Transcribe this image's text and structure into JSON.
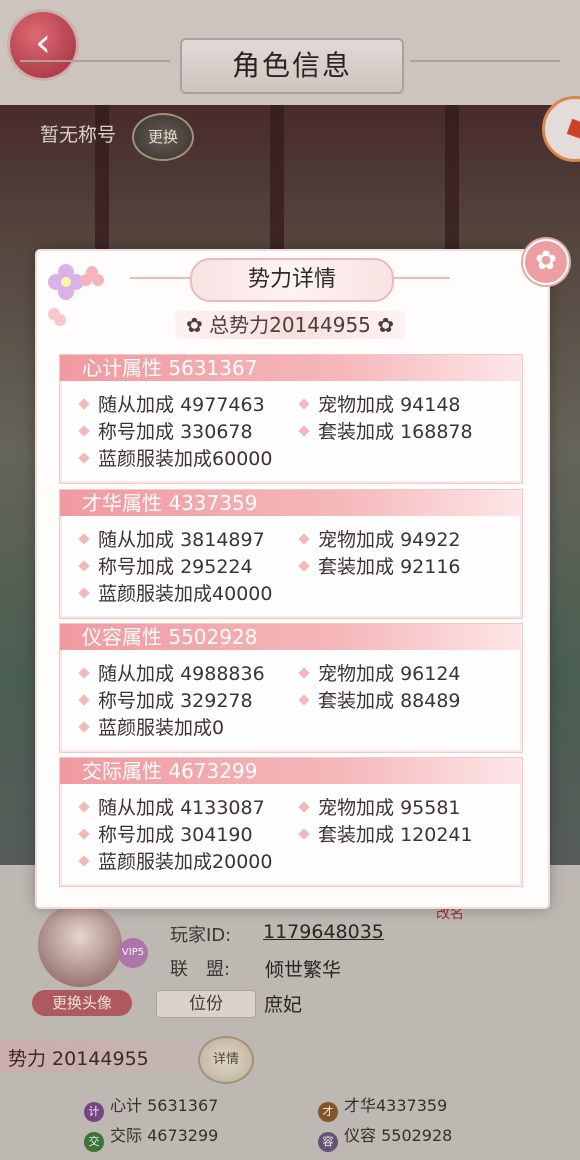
{
  "header": {
    "title": "角色信息",
    "back_icon": "‹"
  },
  "scene": {
    "no_title": "暂无称号",
    "change_label": "更换"
  },
  "modal": {
    "title": "势力详情",
    "total_power": "总势力20144955",
    "close_icon": "✿",
    "sections": [
      {
        "title": "心计属性 5631367",
        "rows": [
          {
            "label": "随从加成",
            "value": "4977463"
          },
          {
            "label": "宠物加成",
            "value": "94148"
          },
          {
            "label": "称号加成",
            "value": "330678"
          },
          {
            "label": "套装加成",
            "value": "168878"
          },
          {
            "label": "蓝颜服装加成",
            "value": "60000"
          }
        ]
      },
      {
        "title": "才华属性 4337359",
        "rows": [
          {
            "label": "随从加成",
            "value": "3814897"
          },
          {
            "label": "宠物加成",
            "value": "94922"
          },
          {
            "label": "称号加成",
            "value": "295224"
          },
          {
            "label": "套装加成",
            "value": "92116"
          },
          {
            "label": "蓝颜服装加成",
            "value": "40000"
          }
        ]
      },
      {
        "title": "仪容属性 5502928",
        "rows": [
          {
            "label": "随从加成",
            "value": "4988836"
          },
          {
            "label": "宠物加成",
            "value": "96124"
          },
          {
            "label": "称号加成",
            "value": "329278"
          },
          {
            "label": "套装加成",
            "value": "88489"
          },
          {
            "label": "蓝颜服装加成",
            "value": "0"
          }
        ]
      },
      {
        "title": "交际属性 4673299",
        "rows": [
          {
            "label": "随从加成",
            "value": "4133087"
          },
          {
            "label": "宠物加成",
            "value": "95581"
          },
          {
            "label": "称号加成",
            "value": "304190"
          },
          {
            "label": "套装加成",
            "value": "120241"
          },
          {
            "label": "蓝颜服装加成",
            "value": "20000"
          }
        ]
      }
    ]
  },
  "profile": {
    "vip": "VIP5",
    "player_id_label": "玩家ID:",
    "player_id": "1179648035",
    "alliance_label": "联　盟:",
    "alliance": "倾世繁华",
    "rename_label": "改名",
    "change_avatar": "更换头像",
    "rank_label": "位份",
    "rank_value": "庶妃",
    "power_total": "势力 20144955",
    "detail_label": "详情",
    "attributes": [
      {
        "icon": "计",
        "label": "心计 5631367",
        "color": "#7a4b8c"
      },
      {
        "icon": "才",
        "label": "才华4337359",
        "color": "#8a5a2e"
      },
      {
        "icon": "交",
        "label": "交际 4673299",
        "color": "#3f7a3c"
      },
      {
        "icon": "容",
        "label": "仪容 5502928",
        "color": "#6b5a7a"
      }
    ]
  },
  "colors": {
    "accent_pink": "#f09aa0",
    "plaque_border": "#eeb9b9",
    "text_dark": "#3b3431"
  }
}
